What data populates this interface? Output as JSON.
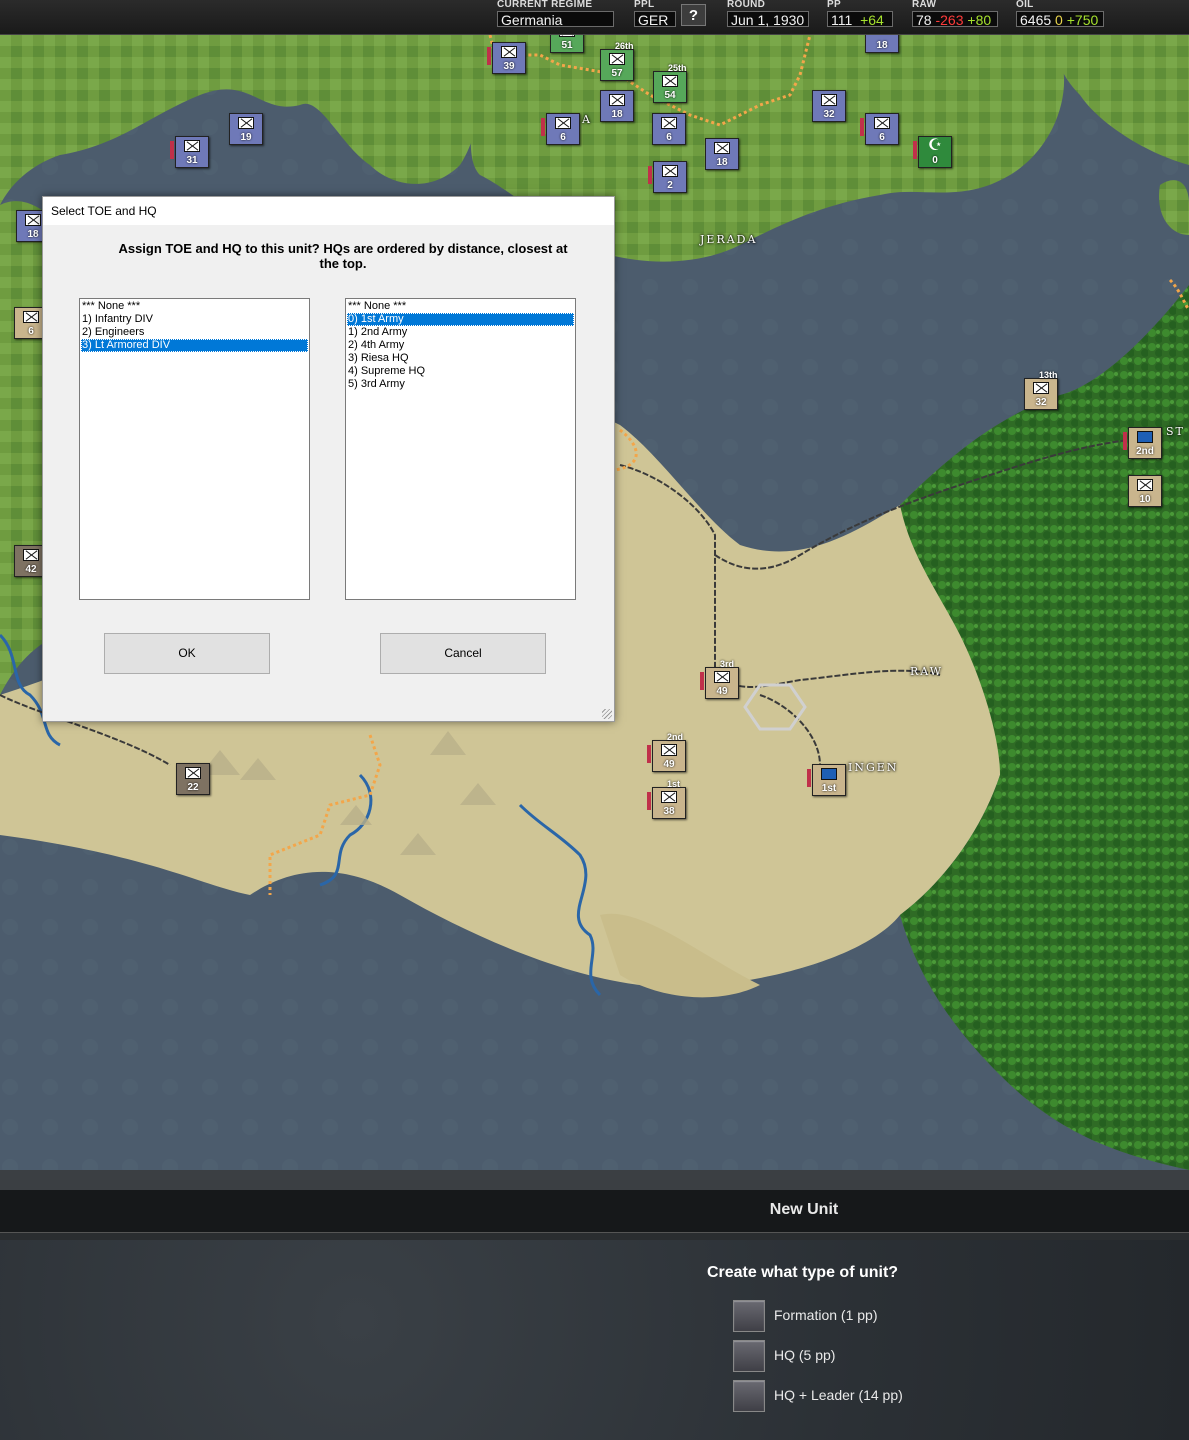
{
  "topbar": {
    "regime": {
      "label": "CURRENT REGIME",
      "value": "Germania"
    },
    "ppl": {
      "label": "PPL",
      "value": "GER"
    },
    "help": "?",
    "round": {
      "label": "ROUND",
      "value": "Jun 1, 1930"
    },
    "pp": {
      "label": "PP",
      "value": "111",
      "delta": "+64"
    },
    "raw": {
      "label": "RAW",
      "value": "78",
      "minus": "-263",
      "plus": "+80"
    },
    "oil": {
      "label": "OIL",
      "value": "6465",
      "zero": "0",
      "plus": "+750"
    }
  },
  "map": {
    "cities": [
      "JERADA",
      "RAW",
      "INGEN",
      "ST",
      "A",
      "A"
    ],
    "units": [
      {
        "num": "39"
      },
      {
        "num": "51"
      },
      {
        "num": "57",
        "tag": "26th"
      },
      {
        "num": "54",
        "tag": "25th"
      },
      {
        "num": "18"
      },
      {
        "num": "6"
      },
      {
        "num": "6"
      },
      {
        "num": "2"
      },
      {
        "num": "18"
      },
      {
        "num": "32"
      },
      {
        "num": "6"
      },
      {
        "num": "0"
      },
      {
        "num": "18"
      },
      {
        "num": "19"
      },
      {
        "num": "31"
      },
      {
        "num": "18"
      },
      {
        "num": "6"
      },
      {
        "num": "42"
      },
      {
        "num": "22"
      },
      {
        "num": "32",
        "tag": "13th"
      },
      {
        "num": "2nd"
      },
      {
        "num": "10"
      },
      {
        "num": "49",
        "tag": "3rd"
      },
      {
        "num": "49",
        "tag": "2nd"
      },
      {
        "num": "38",
        "tag": "1st"
      },
      {
        "num": "1st"
      }
    ]
  },
  "dialog": {
    "title": "Select TOE and HQ",
    "prompt": "Assign TOE and HQ to this unit? HQs are ordered by distance, closest at the top.",
    "toe_list": [
      "*** None ***",
      "1) Infantry DIV",
      "2) Engineers",
      "3) Lt Armored DIV"
    ],
    "toe_selected": 3,
    "hq_list": [
      "*** None ***",
      "0) 1st Army",
      "1) 2nd Army",
      "2) 4th Army",
      "3) Riesa HQ",
      "4) Supreme HQ",
      "5) 3rd Army"
    ],
    "hq_selected": 1,
    "ok": "OK",
    "cancel": "Cancel"
  },
  "panel": {
    "header": "New Unit",
    "question": "Create what type of unit?",
    "options": [
      "Formation (1 pp)",
      "HQ (5 pp)",
      "HQ + Leader (14 pp)"
    ]
  },
  "colors": {
    "sea": "#4a5a6b",
    "grassland": "#6fa043",
    "forest": "#2d6a24",
    "desert": "#cfc596",
    "border_dots": "#f3a64a",
    "selection": "#0078d7"
  }
}
